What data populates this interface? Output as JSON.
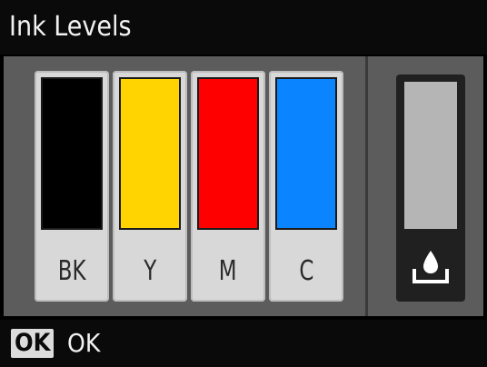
{
  "title": "Ink Levels",
  "cartridges": [
    {
      "label": "BK",
      "color": "#000000",
      "level": 1.0
    },
    {
      "label": "Y",
      "color": "#ffd400",
      "level": 1.0
    },
    {
      "label": "M",
      "color": "#ff0000",
      "level": 1.0
    },
    {
      "label": "C",
      "color": "#0a84ff",
      "level": 1.0
    }
  ],
  "maintenance_box": {
    "icon": "ink-drop-tray-icon",
    "fill_color": "#b5b5b5",
    "level": 1.0
  },
  "footer": {
    "ok_badge": "OK",
    "ok_label": "OK"
  }
}
